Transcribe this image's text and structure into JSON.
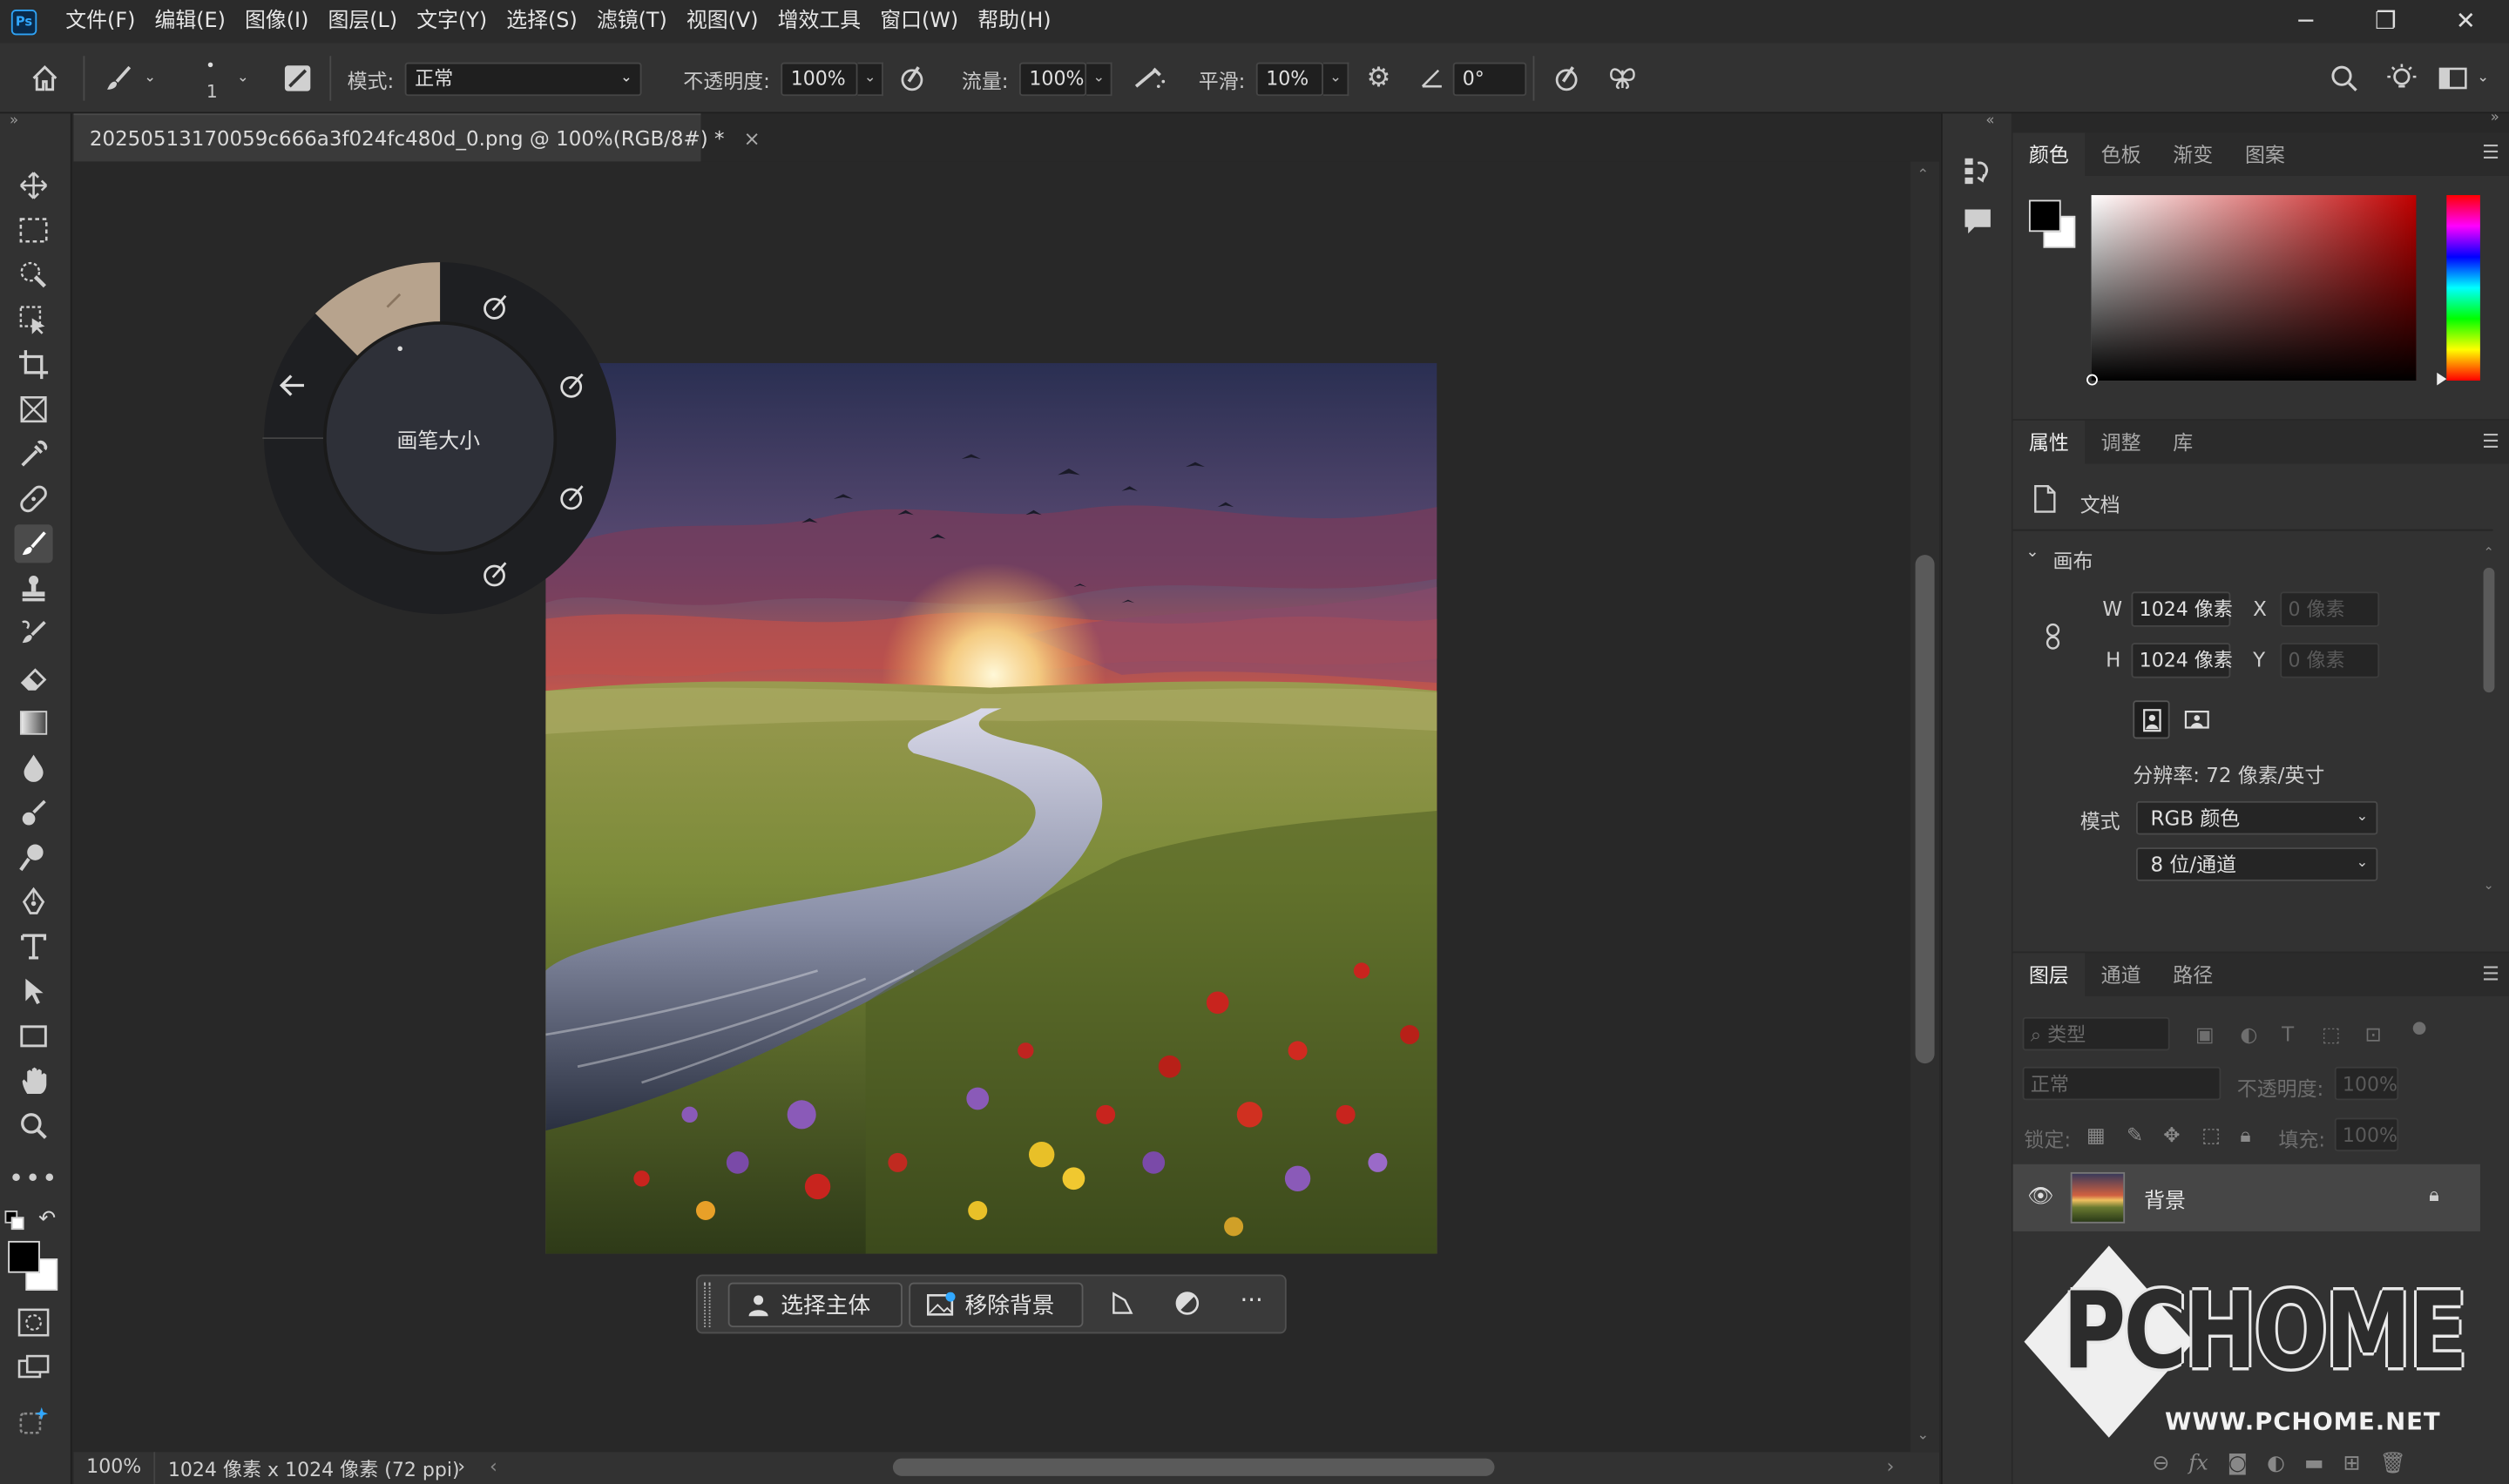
{
  "app": {
    "logo": "Ps"
  },
  "menu": [
    "文件(F)",
    "编辑(E)",
    "图像(I)",
    "图层(L)",
    "文字(Y)",
    "选择(S)",
    "滤镜(T)",
    "视图(V)",
    "增效工具",
    "窗口(W)",
    "帮助(H)"
  ],
  "window_controls": {
    "minimize": "─",
    "restore": "❐",
    "close": "✕"
  },
  "options": {
    "brush_size": "1",
    "mode_label": "模式:",
    "mode_value": "正常",
    "opacity_label": "不透明度:",
    "opacity_value": "100%",
    "flow_label": "流量:",
    "flow_value": "100%",
    "smooth_label": "平滑:",
    "smooth_value": "10%",
    "angle_value": "0°"
  },
  "document": {
    "tab_title": "20250513170059c666a3f024fc480d_0.png @ 100%(RGB/8#) *",
    "tab_close": "×",
    "zoom": "100%",
    "info": "1024 像素 x 1024 像素 (72 ppi)"
  },
  "radial_menu": {
    "center_label": "画笔大小"
  },
  "contextual_bar": {
    "select_subject": "选择主体",
    "remove_bg": "移除背景",
    "more": "···"
  },
  "color_panel": {
    "tabs": [
      "颜色",
      "色板",
      "渐变",
      "图案"
    ],
    "fg": "#000000",
    "bg": "#ffffff"
  },
  "properties_panel": {
    "tabs": [
      "属性",
      "调整",
      "库"
    ],
    "doc_label": "文档",
    "section": "画布",
    "w_label": "W",
    "w_value": "1024 像素",
    "h_label": "H",
    "h_value": "1024 像素",
    "x_label": "X",
    "x_value": "0 像素",
    "y_label": "Y",
    "y_value": "0 像素",
    "resolution": "分辨率: 72 像素/英寸",
    "mode_label": "模式",
    "mode_value": "RGB 颜色",
    "depth_value": "8 位/通道"
  },
  "layers_panel": {
    "tabs": [
      "图层",
      "通道",
      "路径"
    ],
    "kind_placeholder": "类型",
    "blend": "正常",
    "opacity_label": "不透明度:",
    "opacity_value": "100%",
    "lock_label": "锁定:",
    "fill_label": "填充:",
    "fill_value": "100%",
    "layer_name": "背景",
    "bottom_fx": "fx"
  },
  "watermark": {
    "brand": "PCHOME",
    "url": "WWW.PCHOME.NET"
  }
}
